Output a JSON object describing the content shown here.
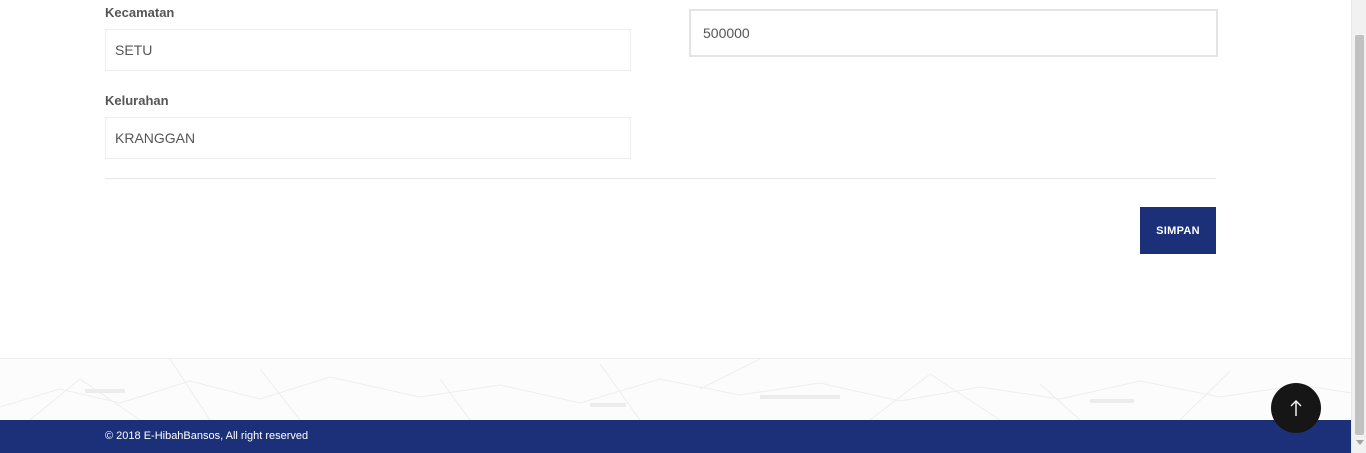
{
  "form": {
    "kecamatan": {
      "label": "Kecamatan",
      "value": "SETU"
    },
    "kelurahan": {
      "label": "Kelurahan",
      "value": "KRANGGAN"
    },
    "amount": {
      "value": "500000"
    },
    "submit_label": "SIMPAN"
  },
  "footer": {
    "copyright": "© 2018 E-HibahBansos, All right reserved"
  },
  "icons": {
    "back_to_top": "arrow-up-icon"
  },
  "colors": {
    "primary": "#1c307a",
    "back_to_top_bg": "#161616"
  }
}
